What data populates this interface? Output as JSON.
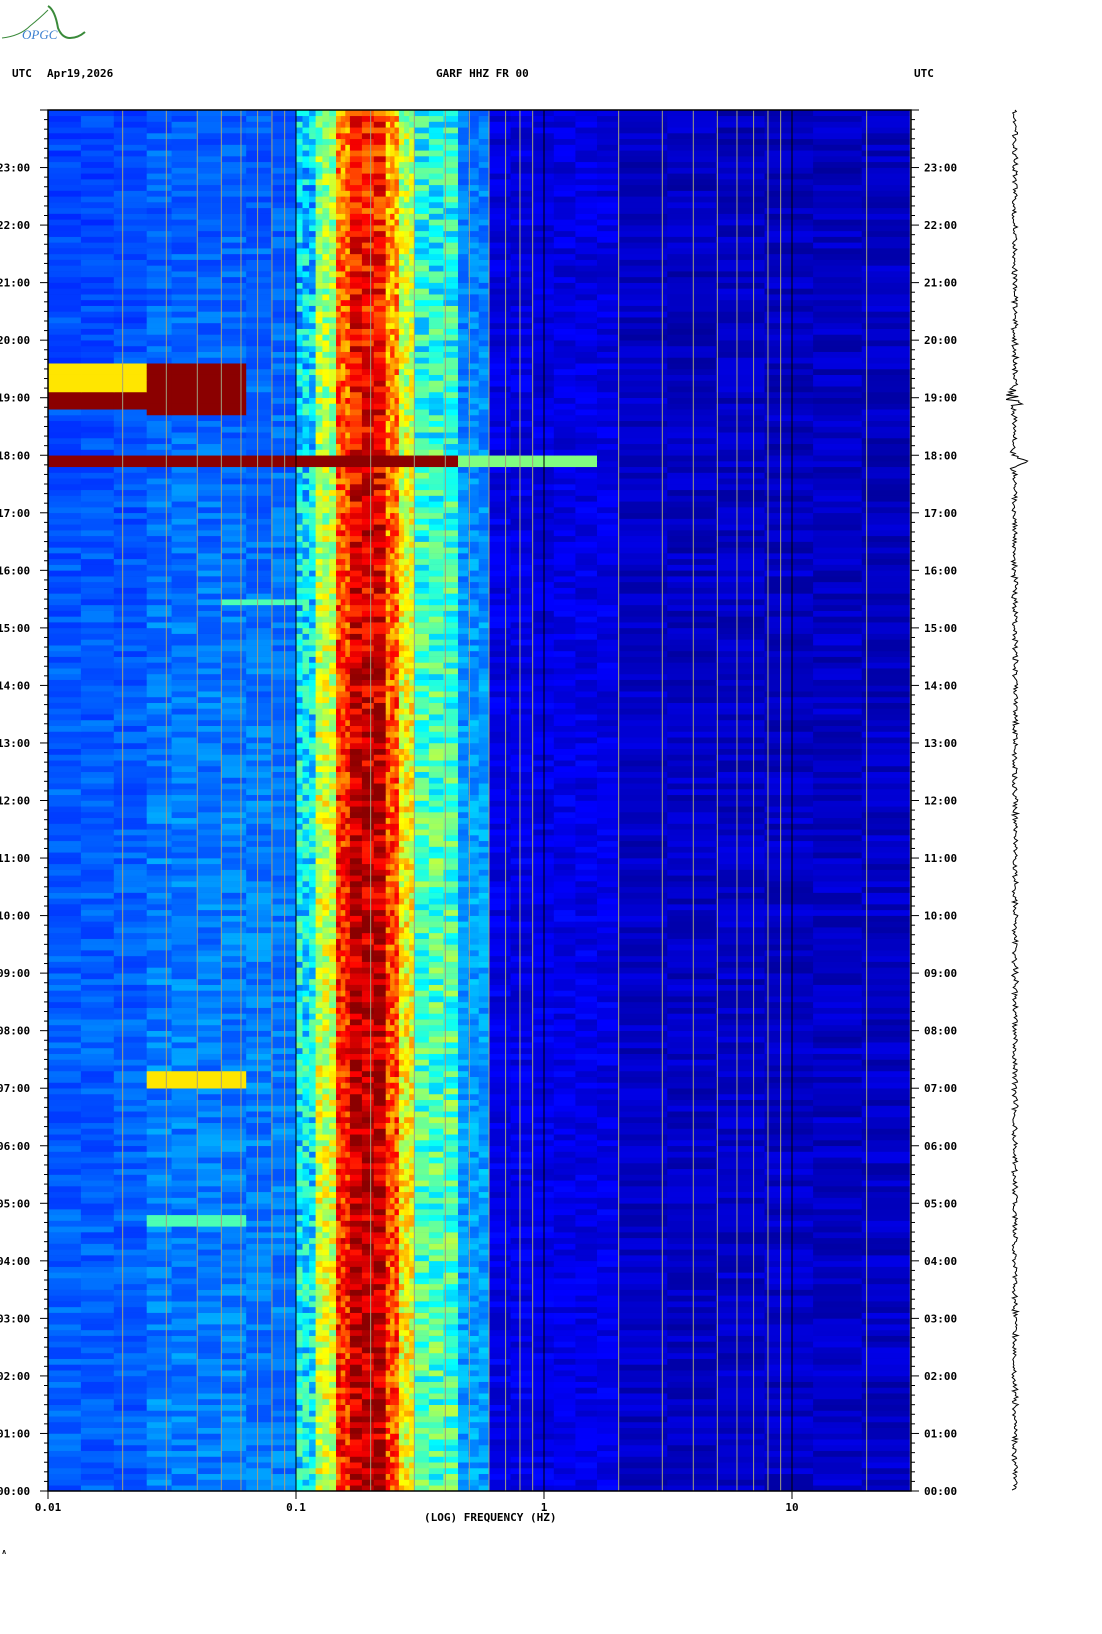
{
  "header": {
    "left_tz": "UTC",
    "date": "Apr19,2026",
    "station": "GARF HHZ FR 00",
    "right_tz": "UTC",
    "logo_text": "OPGC"
  },
  "footer_mark": "ʌ",
  "chart_data": {
    "type": "heatmap",
    "title": "GARF HHZ FR 00",
    "xlabel": "(LOG) FREQUENCY (HZ)",
    "ylabel": "UTC",
    "x_scale": "log",
    "xlim": [
      0.01,
      30
    ],
    "ylim_hours": [
      0,
      24
    ],
    "x_tick_labels": [
      {
        "v": 0.01,
        "t": "0.01"
      },
      {
        "v": 0.1,
        "t": "0.1"
      },
      {
        "v": 1,
        "t": "1"
      },
      {
        "v": 10,
        "t": "10"
      }
    ],
    "y_tick_labels": [
      "00:00",
      "01:00",
      "02:00",
      "03:00",
      "04:00",
      "05:00",
      "06:00",
      "07:00",
      "08:00",
      "09:00",
      "10:00",
      "11:00",
      "12:00",
      "13:00",
      "14:00",
      "15:00",
      "16:00",
      "17:00",
      "18:00",
      "19:00",
      "20:00",
      "21:00",
      "22:00",
      "23:00"
    ],
    "colormap": [
      "#00008f",
      "#0000ff",
      "#0060ff",
      "#00ffff",
      "#80ff80",
      "#ffff00",
      "#ff8000",
      "#ff0000",
      "#8b0000"
    ],
    "band_profile": [
      {
        "f": [
          0.01,
          0.025
        ],
        "level": 0.24
      },
      {
        "f": [
          0.025,
          0.1
        ],
        "level": 0.27
      },
      {
        "f": [
          0.1,
          0.12
        ],
        "level": 0.38
      },
      {
        "f": [
          0.12,
          0.145
        ],
        "level": 0.58
      },
      {
        "f": [
          0.145,
          0.165
        ],
        "level": 0.84
      },
      {
        "f": [
          0.165,
          0.23
        ],
        "level": 0.95
      },
      {
        "f": [
          0.23,
          0.26
        ],
        "level": 0.8
      },
      {
        "f": [
          0.26,
          0.3
        ],
        "level": 0.62
      },
      {
        "f": [
          0.3,
          0.45
        ],
        "level": 0.45
      },
      {
        "f": [
          0.45,
          0.6
        ],
        "level": 0.3
      },
      {
        "f": [
          0.6,
          2
        ],
        "level": 0.1
      },
      {
        "f": [
          2,
          30
        ],
        "level": 0.06
      }
    ],
    "events": [
      {
        "hours": [
          17.85,
          17.95
        ],
        "f": [
          0.01,
          0.45
        ],
        "level": 1.0
      },
      {
        "hours": [
          17.85,
          17.95
        ],
        "f": [
          0.45,
          1.6
        ],
        "level": 0.5
      },
      {
        "hours": [
          18.75,
          19.55
        ],
        "f": [
          0.025,
          0.07
        ],
        "level": 1.0
      },
      {
        "hours": [
          18.8,
          19.1
        ],
        "f": [
          0.01,
          0.025
        ],
        "level": 1.0
      },
      {
        "hours": [
          19.1,
          19.6
        ],
        "f": [
          0.01,
          0.025
        ],
        "level": 0.65
      },
      {
        "hours": [
          7.05,
          7.3
        ],
        "f": [
          0.025,
          0.07
        ],
        "level": 0.65
      },
      {
        "hours": [
          4.65,
          4.75
        ],
        "f": [
          0.025,
          0.07
        ],
        "level": 0.45
      },
      {
        "hours": [
          15.4,
          15.5
        ],
        "f": [
          0.05,
          0.1
        ],
        "level": 0.45
      }
    ],
    "seismogram_events_hours": [
      19.0,
      17.9
    ]
  }
}
